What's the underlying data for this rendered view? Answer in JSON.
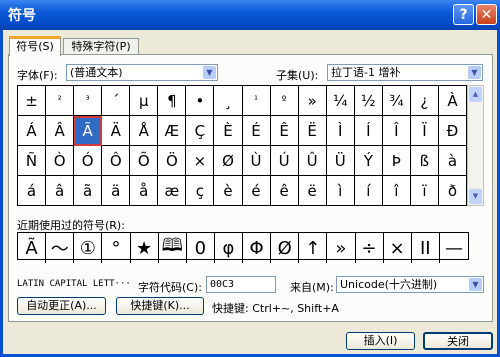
{
  "window": {
    "title": "符号"
  },
  "tabs": [
    {
      "label": "符号(S)"
    },
    {
      "label": "特殊字符(P)"
    }
  ],
  "font": {
    "label": "字体(F):",
    "value": "(普通文本)"
  },
  "subset": {
    "label": "子集(U):",
    "value": "拉丁语-1 增补"
  },
  "grid": [
    [
      "±",
      "²",
      "³",
      "´",
      "µ",
      "¶",
      "•",
      "¸",
      "¹",
      "º",
      "»",
      "¼",
      "½",
      "¾",
      "¿",
      "À"
    ],
    [
      "Á",
      "Â",
      "Ã",
      "Ä",
      "Å",
      "Æ",
      "Ç",
      "È",
      "É",
      "Ê",
      "Ë",
      "Ì",
      "Í",
      "Î",
      "Ï",
      "Ð"
    ],
    [
      "Ñ",
      "Ò",
      "Ó",
      "Ô",
      "Õ",
      "Ö",
      "×",
      "Ø",
      "Ù",
      "Ú",
      "Û",
      "Ü",
      "Ý",
      "Þ",
      "ß",
      "à"
    ],
    [
      "á",
      "â",
      "ã",
      "ä",
      "å",
      "æ",
      "ç",
      "è",
      "é",
      "ê",
      "ë",
      "ì",
      "í",
      "î",
      "ï",
      "ð"
    ]
  ],
  "recent": {
    "label": "近期使用过的符号(R):",
    "symbols": [
      "Ã",
      "〜",
      "①",
      "°",
      "★",
      "🕮",
      "0",
      "φ",
      "Φ",
      "Ø",
      "↑",
      "»",
      "÷",
      "×",
      "II",
      "—"
    ]
  },
  "char_name": "LATIN CAPITAL LETT···",
  "char_code": {
    "label": "字符代码(C):",
    "value": "00C3"
  },
  "from": {
    "label": "来自(M):",
    "value": "Unicode(十六进制)"
  },
  "autocorrect": {
    "label": "自动更正(A)..."
  },
  "shortcut_key": {
    "label": "快捷键(K)..."
  },
  "shortcut_text": "快捷键: Ctrl+~, Shift+A",
  "insert": {
    "label": "插入(I)"
  },
  "close": {
    "label": "关闭"
  }
}
